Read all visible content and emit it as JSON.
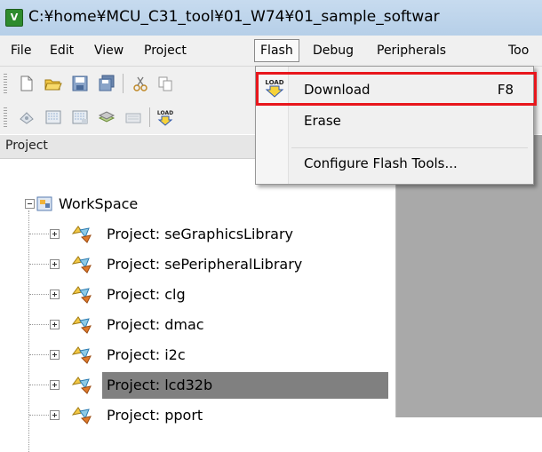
{
  "window": {
    "title": "C:¥home¥MCU_C31_tool¥01_W74¥01_sample_softwar",
    "app_icon": "V"
  },
  "menubar": {
    "items": [
      "File",
      "Edit",
      "View",
      "Project",
      "Flash",
      "Debug",
      "Peripherals",
      "Too"
    ],
    "active": "Flash"
  },
  "flash_menu": {
    "items": [
      {
        "label": "Download",
        "shortcut": "F8",
        "icon": "load-icon"
      },
      {
        "label": "Erase",
        "shortcut": ""
      },
      {
        "label": "Configure Flash Tools...",
        "shortcut": ""
      }
    ],
    "icon_text": "LOAD"
  },
  "toolbar": {
    "row1_icons": [
      "new-file-icon",
      "open-folder-icon",
      "save-icon",
      "save-all-icon",
      "cut-icon",
      "copy-icon"
    ],
    "row2_icons": [
      "translate-icon",
      "build-icon",
      "rebuild-icon",
      "batch-build-icon",
      "stop-build-icon",
      "load-icon"
    ],
    "load_text": "LOAD"
  },
  "project_panel": {
    "title": "Project",
    "root": "WorkSpace",
    "projects": [
      "Project: seGraphicsLibrary",
      "Project: sePeripheralLibrary",
      "Project: clg",
      "Project: dmac",
      "Project: i2c",
      "Project: lcd32b",
      "Project: pport"
    ],
    "selected": "Project: lcd32b"
  },
  "colors": {
    "highlight": "#e8161c",
    "titlebar": "#b9d1ea",
    "selection": "#808080",
    "editor_bg": "#a9a9a9"
  }
}
